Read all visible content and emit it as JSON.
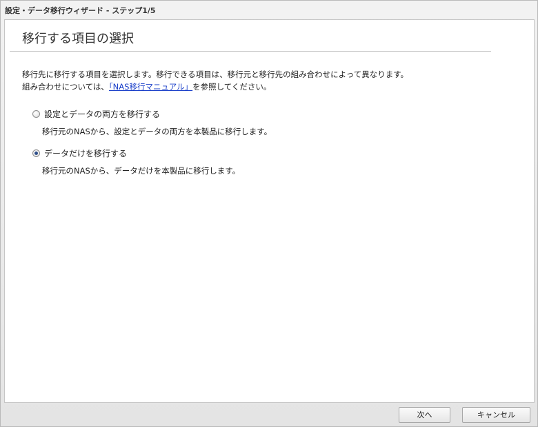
{
  "window": {
    "title": "設定・データ移行ウィザード - ステップ1/5"
  },
  "page": {
    "heading": "移行する項目の選択",
    "desc_line1": "移行先に移行する項目を選択します。移行できる項目は、移行元と移行先の組み合わせによって異なります。",
    "desc_line2_prefix": "組み合わせについては、",
    "desc_line2_link": "「NAS移行マニュアル」",
    "desc_line2_suffix": "を参照してください。"
  },
  "options": [
    {
      "label": "設定とデータの両方を移行する",
      "description": "移行元のNASから、設定とデータの両方を本製品に移行します。",
      "selected": false
    },
    {
      "label": "データだけを移行する",
      "description": "移行元のNASから、データだけを本製品に移行します。",
      "selected": true
    }
  ],
  "footer": {
    "next_label": "次へ",
    "cancel_label": "キャンセル"
  }
}
